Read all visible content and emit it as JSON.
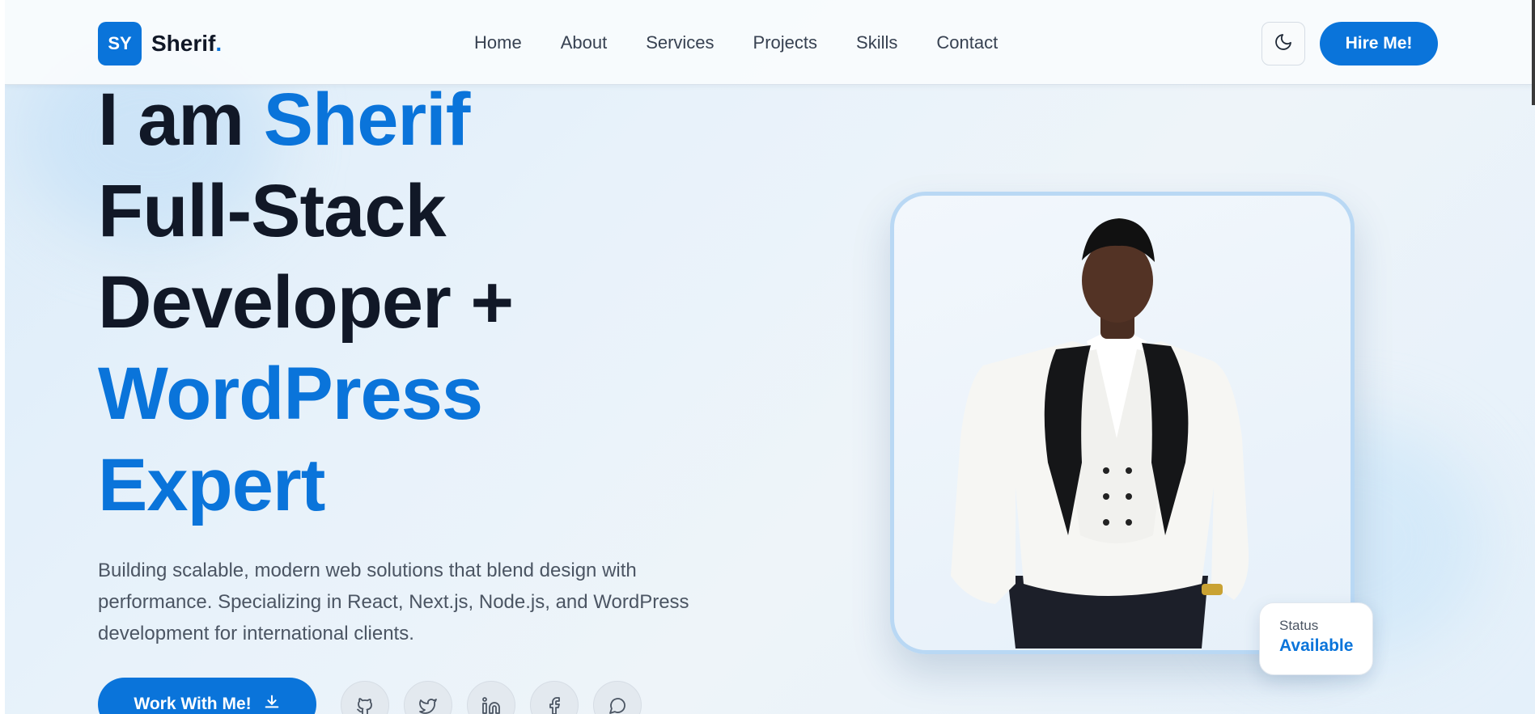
{
  "header": {
    "logo_initials": "SY",
    "logo_name": "Sherif",
    "logo_dot": ".",
    "nav": [
      "Home",
      "About",
      "Services",
      "Projects",
      "Skills",
      "Contact"
    ],
    "theme_toggle_icon": "moon-icon",
    "hire_button": "Hire Me!"
  },
  "hero": {
    "line1_prefix": "I am ",
    "line1_name": "Sherif",
    "line2": "Full-Stack",
    "line3": "Developer +",
    "line4": "WordPress",
    "line5": "Expert",
    "description": "Building scalable, modern web solutions that blend design with performance. Specializing in React, Next.js, Node.js, and WordPress development for international clients.",
    "cta_label": "Work With Me!",
    "cta_icon": "download-icon",
    "socials": [
      "github-icon",
      "twitter-icon",
      "linkedin-icon",
      "facebook-icon",
      "chat-icon"
    ]
  },
  "profile": {
    "status_label": "Status",
    "status_value": "Available"
  },
  "colors": {
    "accent": "#0a74da",
    "heading": "#111827",
    "body_text": "#4b5563"
  }
}
